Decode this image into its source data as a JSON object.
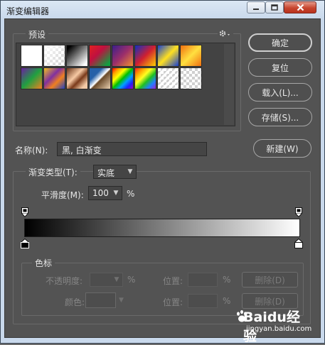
{
  "window": {
    "title": "渐变编辑器"
  },
  "presets": {
    "legend": "预设",
    "swatches": [
      {
        "name": "white",
        "bg": "#ffffff"
      },
      {
        "name": "transparent-white",
        "bg": "linear-gradient(135deg, rgba(255,255,255,0.95), rgba(255,255,255,0)), repeating-conic-gradient(#cfcfcf 0 25%, #ffffff 0 50%) 0 0/8px 8px"
      },
      {
        "name": "black-white",
        "bg": "linear-gradient(135deg, #000000 10%, #ffffff 90%)"
      },
      {
        "name": "red-green",
        "bg": "linear-gradient(135deg, #e02020, #c01040 40%, #10a040 90%)"
      },
      {
        "name": "violet-orange",
        "bg": "linear-gradient(135deg, #3b1e8a, #9c2f6a 50%, #f09030)"
      },
      {
        "name": "blue-red-yellow",
        "bg": "linear-gradient(135deg, #1030c0, #d02030 50%, #ffd000)"
      },
      {
        "name": "blue-yellow-blue",
        "bg": "linear-gradient(135deg, #1840d0, #ffe020 50%, #1840d0)"
      },
      {
        "name": "orange-yellow-orange",
        "bg": "linear-gradient(135deg, #f07010, #ffe040 50%, #f07010)"
      },
      {
        "name": "violet-green-orange",
        "bg": "linear-gradient(135deg, #6a1fa0, #20a040 50%, #f08020)"
      },
      {
        "name": "yellow-violet-orange-blue",
        "bg": "linear-gradient(135deg, #f0c020, #8030a0 40%, #f08020 65%, #2040c0)"
      },
      {
        "name": "copper",
        "bg": "linear-gradient(135deg, #6a3418, #f6c9a4 40%, #7a3a1a 60%, #f3caa6 85%)"
      },
      {
        "name": "chrome",
        "bg": "linear-gradient(135deg, #2560a8 30%, #ffffff 50%, #6a4a2a 55%, #e8d0b0)"
      },
      {
        "name": "spectrum",
        "bg": "linear-gradient(135deg, #ff0000, #ffa000, #ffff00, #00c000, #00a0ff, #2020ff, #a000c0)"
      },
      {
        "name": "transparent-rainbow",
        "bg": "linear-gradient(135deg, #ff2020, #ffa000, #ffff20, #20c020, #2080ff, #a020d0), repeating-conic-gradient(#cfcfcf 0 25%, #ffffff 0 50%) 0 0/8px 8px"
      },
      {
        "name": "transparent-stripes",
        "bg": "repeating-linear-gradient(135deg, rgba(255,255,255,0.9) 0 3px, rgba(255,255,255,0) 3px 6px), repeating-conic-gradient(#cfcfcf 0 25%, #ffffff 0 50%) 0 0/8px 8px"
      },
      {
        "name": "checker",
        "bg": "repeating-conic-gradient(#cfcfcf 0 25%, #ffffff 0 50%) 0 0/8px 8px"
      }
    ]
  },
  "buttons": {
    "ok": "确定",
    "reset": "复位",
    "load": "载入(L)...",
    "save": "存储(S)...",
    "new": "新建(W)"
  },
  "name_row": {
    "label": "名称(N):",
    "value": "黑, 白渐变"
  },
  "gradient_type": {
    "legend_label": "渐变类型(T):",
    "value": "实底"
  },
  "smoothness": {
    "label": "平滑度(M):",
    "value": "100",
    "unit": "%"
  },
  "stops": {
    "legend": "色标",
    "opacity_label": "不透明度:",
    "opacity_unit": "%",
    "location_label_1": "位置:",
    "location_unit_1": "%",
    "delete_label_1": "删除(D)",
    "color_label": "颜色:",
    "location_label_2": "位置:",
    "location_unit_2": "%",
    "delete_label_2": "删除(D)"
  },
  "watermark": {
    "main": "Baidu经验",
    "sub": "jingyan.baidu.com"
  },
  "colors": {
    "panel": "#535353",
    "gradient_start": "#000000",
    "gradient_end": "#ffffff"
  }
}
